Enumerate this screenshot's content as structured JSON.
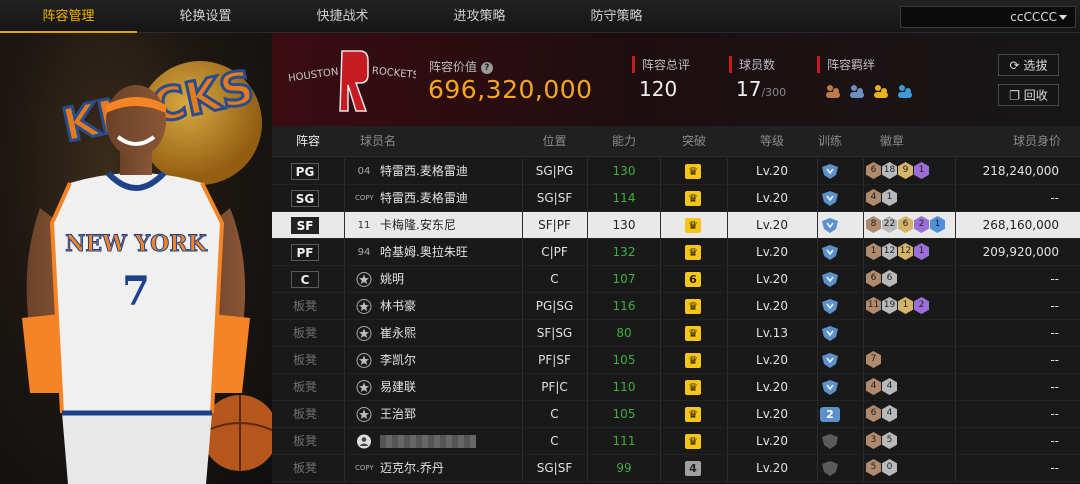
{
  "nav": {
    "tabs": [
      "阵容管理",
      "轮换设置",
      "快捷战术",
      "进攻策略",
      "防守策略"
    ],
    "active_tab": 0,
    "team_select": "ccCCCC"
  },
  "header": {
    "team_logo_text": "HOUSTON ROCKETS",
    "value_label": "阵容价值",
    "value": "696,320,000",
    "rating_label": "阵容总评",
    "rating": "120",
    "count_label": "球员数",
    "count": "17",
    "count_max": "/300",
    "bond_label": "阵容羁绊",
    "pick_button": "选拔",
    "recycle_button": "回收"
  },
  "table": {
    "headers": [
      "阵容",
      "球员名",
      "位置",
      "能力",
      "突破",
      "等级",
      "训练",
      "徽章",
      "球员身价"
    ],
    "rows": [
      {
        "slot": "PG",
        "tag": "04",
        "name": "特雷西.麦格雷迪",
        "pos": "SG|PG",
        "ability": "130",
        "breakthrough": "crown",
        "level": "Lv.20",
        "training": "shield",
        "badges": [
          "6",
          "18",
          "9",
          "1"
        ],
        "value": "218,240,000"
      },
      {
        "slot": "SG",
        "tag": "COPY",
        "name": "特雷西.麦格雷迪",
        "pos": "SG|SF",
        "ability": "114",
        "breakthrough": "crown",
        "level": "Lv.20",
        "training": "shield",
        "badges": [
          "4",
          "1"
        ],
        "value": "--"
      },
      {
        "slot": "SF",
        "tag": "11",
        "name": "卡梅隆.安东尼",
        "pos": "SF|PF",
        "ability": "130",
        "breakthrough": "crown",
        "level": "Lv.20",
        "training": "shield",
        "badges": [
          "8",
          "22",
          "6",
          "2",
          "1"
        ],
        "value": "268,160,000",
        "selected": true
      },
      {
        "slot": "PF",
        "tag": "94",
        "name": "哈基姆.奥拉朱旺",
        "pos": "C|PF",
        "ability": "132",
        "breakthrough": "crown",
        "level": "Lv.20",
        "training": "shield",
        "badges": [
          "1",
          "12",
          "12",
          "1"
        ],
        "value": "209,920,000"
      },
      {
        "slot": "C",
        "tag": "star",
        "name": "姚明",
        "pos": "C",
        "ability": "107",
        "breakthrough": "6",
        "level": "Lv.20",
        "training": "shield",
        "badges": [
          "6",
          "6"
        ],
        "value": "--"
      },
      {
        "slot": "板凳",
        "tag": "star",
        "name": "林书豪",
        "pos": "PG|SG",
        "ability": "116",
        "breakthrough": "crown",
        "level": "Lv.20",
        "training": "shield",
        "badges": [
          "11",
          "19",
          "1",
          "2"
        ],
        "value": "--"
      },
      {
        "slot": "板凳",
        "tag": "star",
        "name": "崔永熙",
        "pos": "SF|SG",
        "ability": "80",
        "breakthrough": "crown",
        "level": "Lv.13",
        "training": "shield",
        "badges": [],
        "value": "--"
      },
      {
        "slot": "板凳",
        "tag": "star",
        "name": "李凯尔",
        "pos": "PF|SF",
        "ability": "105",
        "breakthrough": "crown",
        "level": "Lv.20",
        "training": "shield",
        "badges": [
          "7"
        ],
        "value": "--"
      },
      {
        "slot": "板凳",
        "tag": "star",
        "name": "易建联",
        "pos": "PF|C",
        "ability": "110",
        "breakthrough": "crown",
        "level": "Lv.20",
        "training": "shield",
        "badges": [
          "4",
          "4"
        ],
        "value": "--"
      },
      {
        "slot": "板凳",
        "tag": "star",
        "name": "王治郅",
        "pos": "C",
        "ability": "105",
        "breakthrough": "crown",
        "level": "Lv.20",
        "training": "2",
        "badges": [
          "6",
          "4"
        ],
        "value": "--"
      },
      {
        "slot": "板凳",
        "tag": "user",
        "name": "",
        "pos": "C",
        "ability": "111",
        "breakthrough": "crown",
        "level": "Lv.20",
        "training": "gray",
        "badges": [
          "3",
          "5"
        ],
        "value": "--",
        "redacted": true
      },
      {
        "slot": "板凳",
        "tag": "COPY",
        "name": "迈克尔.乔丹",
        "pos": "SG|SF",
        "ability": "99",
        "breakthrough": "4",
        "level": "Lv.20",
        "training": "gray",
        "badges": [
          "5",
          "0"
        ],
        "value": "--"
      }
    ]
  },
  "colors": {
    "accent": "#f2b300",
    "value_gold": "#f4a620",
    "ability_green": "#3fae3a",
    "crown_yellow": "#f5c518",
    "knicks_orange": "#f58426",
    "knicks_blue": "#1d428a"
  },
  "player_art": {
    "jersey_text": "NEW YORK",
    "jersey_number": "7",
    "logo_text": "KNICKS"
  }
}
